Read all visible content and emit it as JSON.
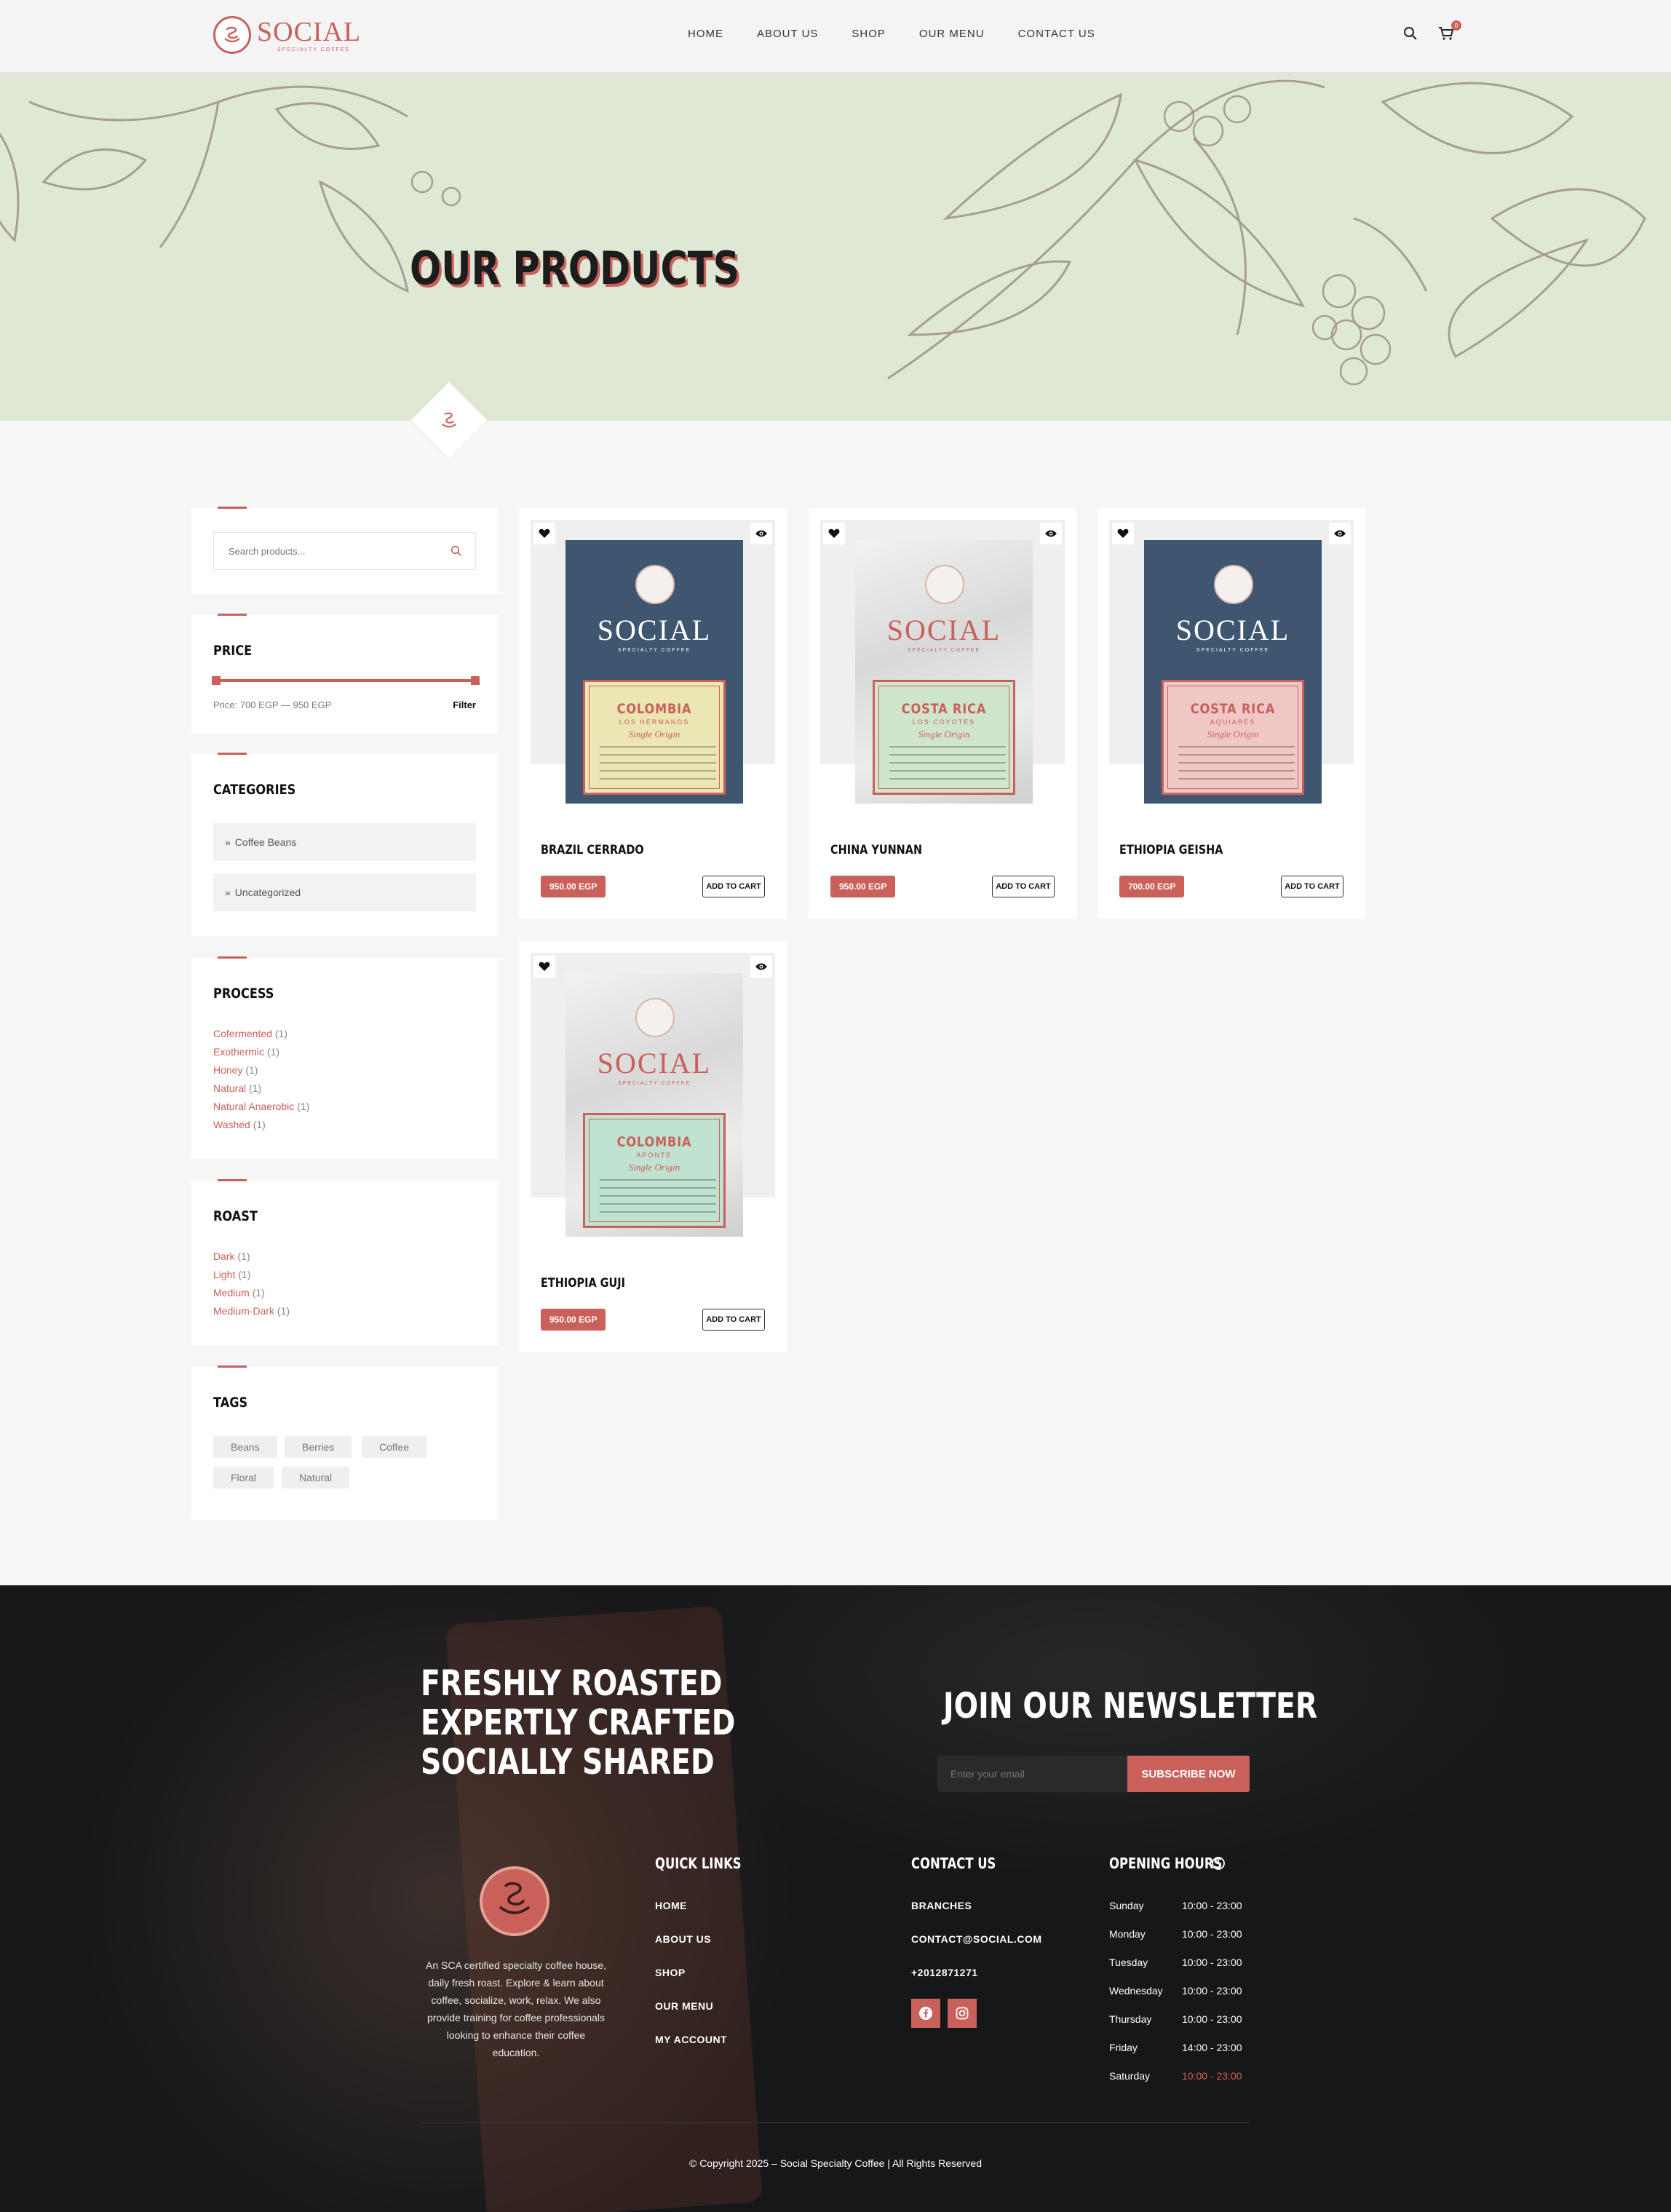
{
  "brand": {
    "name": "SOCIAL",
    "tagline": "SPECIALTY COFFEE",
    "accent": "#c9605a"
  },
  "nav": [
    "HOME",
    "ABOUT US",
    "SHOP",
    "OUR MENU",
    "CONTACT US"
  ],
  "header": {
    "cart_count": "0",
    "icons": [
      "search-icon",
      "cart-icon"
    ]
  },
  "hero": {
    "title": "OUR PRODUCTS",
    "background": "#dfe8d5"
  },
  "sidebar": {
    "search_placeholder": "Search products...",
    "price": {
      "title": "PRICE",
      "label": "Price: 700 EGP — 950 EGP",
      "filter": "Filter",
      "min": 700,
      "max": 950
    },
    "categories": {
      "title": "CATEGORIES",
      "items": [
        "Coffee Beans",
        "Uncategorized"
      ]
    },
    "process": {
      "title": "PROCESS",
      "items": [
        {
          "label": "Cofermented",
          "count": "(1)"
        },
        {
          "label": "Exothermic",
          "count": "(1)"
        },
        {
          "label": "Honey",
          "count": "(1)"
        },
        {
          "label": "Natural",
          "count": "(1)"
        },
        {
          "label": "Natural Anaerobic",
          "count": "(1)"
        },
        {
          "label": "Washed",
          "count": "(1)"
        }
      ]
    },
    "roast": {
      "title": "ROAST",
      "items": [
        {
          "label": "Dark",
          "count": "(1)"
        },
        {
          "label": "Light",
          "count": "(1)"
        },
        {
          "label": "Medium",
          "count": "(1)"
        },
        {
          "label": "Medium-Dark",
          "count": "(1)"
        }
      ]
    },
    "tags": {
      "title": "TAGS",
      "items": [
        "Beans",
        "Berries",
        "Coffee",
        "Floral",
        "Natural"
      ]
    }
  },
  "products": [
    {
      "name": "BRAZIL CERRADO",
      "price": "950.00 EGP",
      "cta": "ADD TO CART",
      "bag": {
        "brand": "SOCIAL",
        "sub": "SPECIALTY COFFEE",
        "origin": "COLOMBIA",
        "farm": "LOS HERMANOS",
        "script": "Single Origin",
        "color": "#3f5670",
        "label": "#ece5b4",
        "brand_color": "#ffffff"
      }
    },
    {
      "name": "CHINA YUNNAN",
      "price": "950.00 EGP",
      "cta": "ADD TO CART",
      "bag": {
        "brand": "SOCIAL",
        "sub": "SPECIALTY COFFEE",
        "origin": "COSTA RICA",
        "farm": "LOS COYOTES",
        "script": "Single Origin",
        "color": "#e4e4e4",
        "label": "#cfe5cc",
        "brand_color": "#c9605a"
      }
    },
    {
      "name": "ETHIOPIA GEISHA",
      "price": "700.00 EGP",
      "cta": "ADD TO CART",
      "bag": {
        "brand": "SOCIAL",
        "sub": "SPECIALTY COFFEE",
        "origin": "COSTA RICA",
        "farm": "AQUIARES",
        "script": "Single Origin",
        "color": "#3f5670",
        "label": "#efc8c6",
        "brand_color": "#ffffff"
      }
    },
    {
      "name": "ETHIOPIA GUJI",
      "price": "950.00 EGP",
      "cta": "ADD TO CART",
      "bag": {
        "brand": "SOCIAL",
        "sub": "SPECIALTY COFFEE",
        "origin": "COLOMBIA",
        "farm": "APONTE",
        "script": "Single Origin",
        "color": "#e4e4e4",
        "label": "#bfe3d0",
        "brand_color": "#c9605a"
      }
    }
  ],
  "footer": {
    "tagline": [
      "FRESHLY ROASTED",
      "EXPERTLY CRAFTED",
      "SOCIALLY SHARED"
    ],
    "newsletter": {
      "title": "JOIN OUR NEWSLETTER",
      "placeholder": "Enter your email",
      "button": "SUBSCRIBE NOW"
    },
    "about": "An SCA certified specialty coffee house, daily fresh roast. Explore & learn about coffee, socialize, work, relax. We also provide training for coffee professionals looking to enhance their coffee education.",
    "quick_links": {
      "title": "QUICK LINKS",
      "items": [
        "HOME",
        "ABOUT US",
        "SHOP",
        "OUR MENU",
        "MY ACCOUNT"
      ]
    },
    "contact": {
      "title": "CONTACT US",
      "items": [
        "BRANCHES",
        "CONTACT@SOCIAL.COM",
        "+2012871271"
      ],
      "socials": [
        "facebook-icon",
        "instagram-icon"
      ]
    },
    "hours": {
      "title": "OPENING HOURS",
      "items": [
        {
          "day": "Sunday",
          "time": "10:00 - 23:00"
        },
        {
          "day": "Monday",
          "time": "10:00 - 23:00"
        },
        {
          "day": "Tuesday",
          "time": "10:00 - 23:00"
        },
        {
          "day": "Wednesday",
          "time": "10:00 - 23:00"
        },
        {
          "day": "Thursday",
          "time": "10:00 - 23:00"
        },
        {
          "day": "Friday",
          "time": "14:00 - 23:00"
        },
        {
          "day": "Saturday",
          "time": "10:00 - 23:00"
        }
      ]
    },
    "copyright": "© Copyright 2025 – Social Specialty Coffee | All Rights Reserved"
  }
}
